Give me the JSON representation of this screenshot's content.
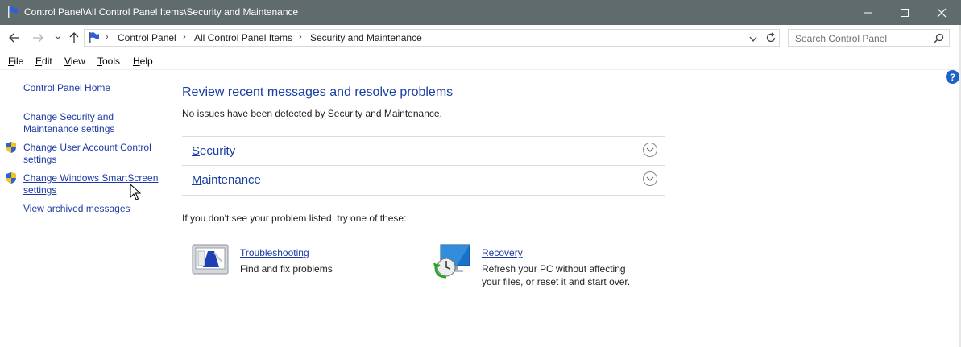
{
  "window": {
    "title": "Control Panel\\All Control Panel Items\\Security and Maintenance"
  },
  "address": {
    "crumbs": [
      "Control Panel",
      "All Control Panel Items",
      "Security and Maintenance"
    ],
    "search_placeholder": "Search Control Panel"
  },
  "menu": {
    "items": [
      {
        "key": "F",
        "rest": "ile"
      },
      {
        "key": "E",
        "rest": "dit"
      },
      {
        "key": "V",
        "rest": "iew"
      },
      {
        "key": "T",
        "rest": "ools"
      },
      {
        "key": "H",
        "rest": "elp"
      }
    ]
  },
  "help_button": "?",
  "sidebar": {
    "home": "Control Panel Home",
    "change_security_1": "Change Security and",
    "change_security_2": "Maintenance settings",
    "uac_1": "Change User Account Control",
    "uac_2": "settings",
    "smartscreen_1": "Change Windows SmartScreen",
    "smartscreen_2": "settings",
    "archived": "View archived messages"
  },
  "main": {
    "heading": "Review recent messages and resolve problems",
    "status": "No issues have been detected by Security and Maintenance.",
    "sections": [
      {
        "key": "S",
        "rest": "ecurity"
      },
      {
        "key": "M",
        "rest": "aintenance"
      }
    ],
    "try_text": "If you don't see your problem listed, try one of these:",
    "troubleshooting": {
      "key": "T",
      "rest": "roubleshooting",
      "desc": "Find and fix problems"
    },
    "recovery": {
      "key": "R",
      "rest": "ecovery",
      "desc_1": "Refresh your PC without affecting",
      "desc_2": "your files, or reset it and start over."
    }
  },
  "colors": {
    "titlebar": "#5f6b6d",
    "link": "#1c3aa5",
    "heading": "#1a3fa3",
    "help": "#1d63c7"
  }
}
